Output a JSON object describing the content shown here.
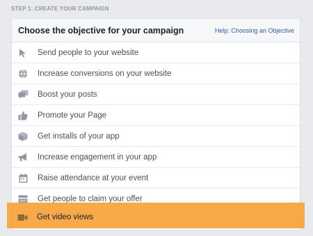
{
  "step_label": "STEP 1: CREATE YOUR CAMPAIGN",
  "panel": {
    "title": "Choose the objective for your campaign",
    "help_link": "Help: Choosing an Objective"
  },
  "objectives": [
    {
      "label": "Send people to your website",
      "icon": "cursor-icon"
    },
    {
      "label": "Increase conversions on your website",
      "icon": "globe-icon"
    },
    {
      "label": "Boost your posts",
      "icon": "chat-bubbles-icon"
    },
    {
      "label": "Promote your Page",
      "icon": "thumbs-up-icon"
    },
    {
      "label": "Get installs of your app",
      "icon": "box-icon"
    },
    {
      "label": "Increase engagement in your app",
      "icon": "megaphone-icon"
    },
    {
      "label": "Raise attendance at your event",
      "icon": "calendar-icon"
    },
    {
      "label": "Get people to claim your offer",
      "icon": "offer-tag-icon"
    },
    {
      "label": "Get video views",
      "icon": "video-camera-icon"
    }
  ],
  "colors": {
    "highlight": "#f7a23a",
    "icon": "#9197a3",
    "link": "#365899"
  }
}
